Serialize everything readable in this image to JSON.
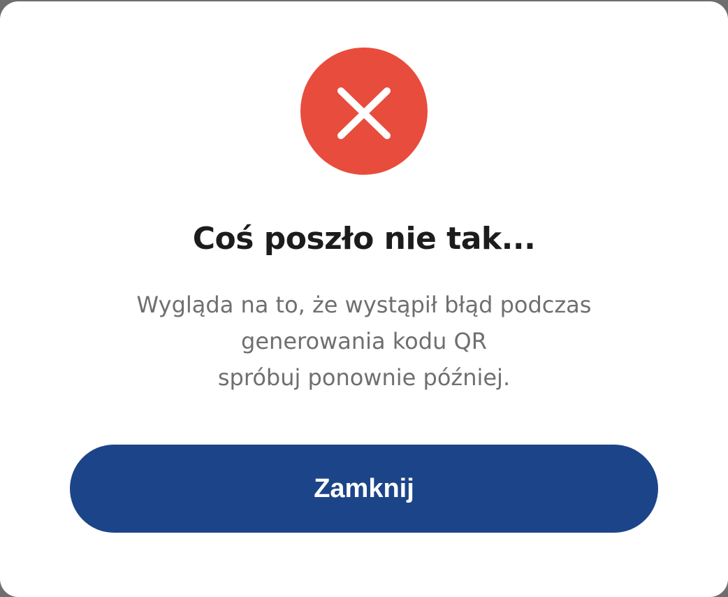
{
  "icon": {
    "name": "close-icon",
    "circle_color": "#e84c3d",
    "glyph_color": "#ffffff"
  },
  "dialog": {
    "title": "Coś poszło nie tak...",
    "message_lines": [
      "Wygląda na to, że wystąpił błąd podczas",
      "generowania kodu QR",
      "spróbuj ponownie później."
    ],
    "button_label": "Zamknij",
    "button_color": "#1c4589"
  }
}
